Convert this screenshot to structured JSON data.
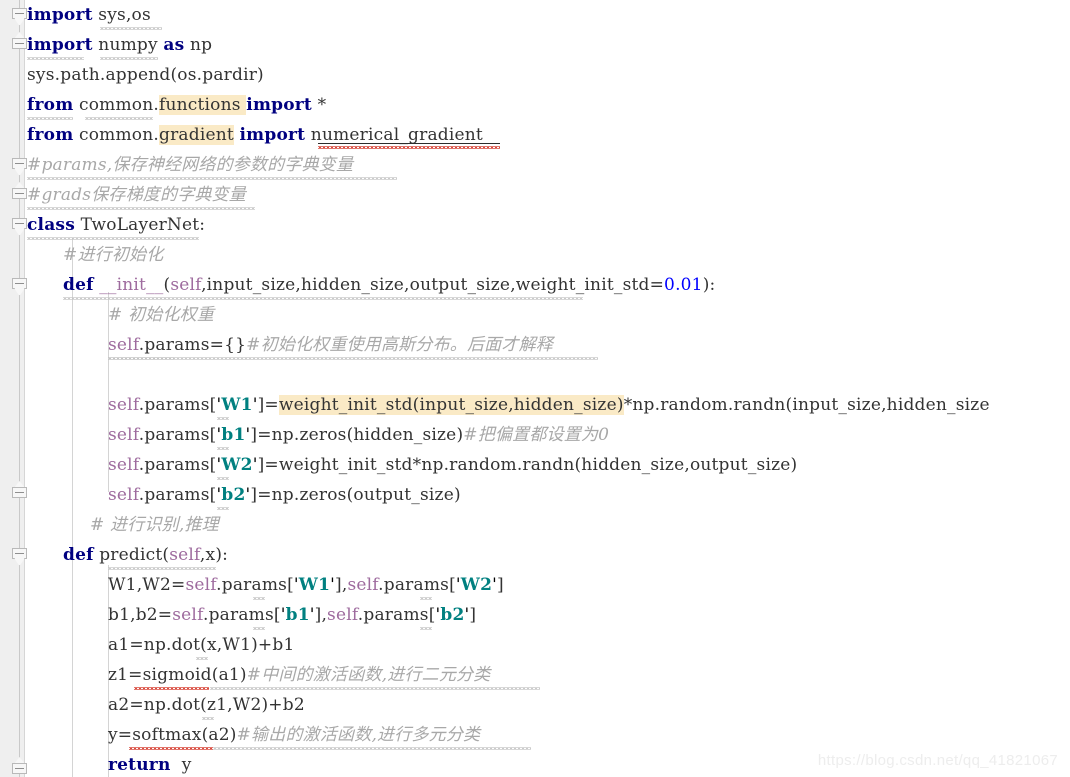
{
  "editor": {
    "language": "python",
    "font_size_px": 17,
    "line_height_px": 30,
    "background": "#ffffff",
    "gutter_background": "#efefef",
    "highlight_color": "#faeac6",
    "comment_color": "#a8a8a8",
    "keyword_color": "#000080",
    "string_color": "#008080",
    "self_color": "#9e6b9e",
    "number_color": "#0000ff"
  },
  "watermark": {
    "text": "https://blog.csdn.net/qq_41821067"
  },
  "gutter": {
    "fold_markers": [
      {
        "name": "fold-marker-import-sys",
        "type": "cap-down"
      },
      {
        "name": "fold-marker-import-numpy",
        "type": "cap-up"
      },
      {
        "name": "fold-marker-comment-params",
        "type": "cap-down"
      },
      {
        "name": "fold-marker-comment-grads",
        "type": "cap-up"
      },
      {
        "name": "fold-marker-class-twolayernet",
        "type": "cap-down"
      },
      {
        "name": "fold-marker-def-init",
        "type": "cap-down"
      },
      {
        "name": "fold-marker-init-end",
        "type": "cap-up"
      },
      {
        "name": "fold-marker-def-predict",
        "type": "cap-down"
      },
      {
        "name": "fold-marker-predict-end",
        "type": "cap-up"
      }
    ]
  },
  "code": {
    "lines": [
      {
        "n": 1,
        "name": "code-line-import-sys-os",
        "text": "import sys,os",
        "tokens": [
          {
            "t": "import",
            "c": "kw"
          },
          {
            "t": " sys,os",
            "c": "plain"
          }
        ]
      },
      {
        "n": 2,
        "name": "code-line-import-numpy",
        "text": "import numpy as np",
        "tokens": [
          {
            "t": "import",
            "c": "kw"
          },
          {
            "t": " numpy ",
            "c": "plain"
          },
          {
            "t": "as",
            "c": "kw"
          },
          {
            "t": " np",
            "c": "plain"
          }
        ]
      },
      {
        "n": 3,
        "name": "code-line-sys-path-append",
        "text": "sys.path.append(os.pardir)",
        "tokens": [
          {
            "t": "sys.path.append(os.pardir)",
            "c": "plain"
          }
        ]
      },
      {
        "n": 4,
        "name": "code-line-from-common-functions",
        "text": "from common.functions import *",
        "tokens": [
          {
            "t": "from",
            "c": "kw"
          },
          {
            "t": " common.",
            "c": "plain"
          },
          {
            "t": "functions",
            "c": "plain hl"
          },
          {
            "t": " ",
            "c": "plain hl"
          },
          {
            "t": "import",
            "c": "kw"
          },
          {
            "t": " *",
            "c": "plain"
          }
        ]
      },
      {
        "n": 5,
        "name": "code-line-from-common-gradient",
        "text": "from common.gradient import numerical_gradient",
        "tokens": [
          {
            "t": "from",
            "c": "kw"
          },
          {
            "t": " common.",
            "c": "plain"
          },
          {
            "t": "gradient",
            "c": "plain hl"
          },
          {
            "t": " ",
            "c": "plain"
          },
          {
            "t": "import",
            "c": "kw"
          },
          {
            "t": " numerical_gradient",
            "c": "plain"
          }
        ]
      },
      {
        "n": 6,
        "name": "code-line-comment-params",
        "text": "#params,保存神经网络的参数的字典变量",
        "tokens": [
          {
            "t": "#params,保存神经网络的参数的字典变量",
            "c": "cmt"
          }
        ]
      },
      {
        "n": 7,
        "name": "code-line-comment-grads",
        "text": "#grads保存梯度的字典变量",
        "tokens": [
          {
            "t": "#grads保存梯度的字典变量",
            "c": "cmt"
          }
        ]
      },
      {
        "n": 8,
        "name": "code-line-class-twolayernet",
        "text": "class TwoLayerNet:",
        "tokens": [
          {
            "t": "class",
            "c": "kw"
          },
          {
            "t": " TwoLayerNet:",
            "c": "plain"
          }
        ]
      },
      {
        "n": 9,
        "name": "code-line-comment-init",
        "text": "#进行初始化",
        "tokens": [
          {
            "t": "#进行初始化",
            "c": "cmt"
          }
        ]
      },
      {
        "n": 10,
        "name": "code-line-def-init",
        "text": "def __init__(self,input_size,hidden_size,output_size,weight_init_std=0.01):",
        "tokens": [
          {
            "t": "def",
            "c": "kw"
          },
          {
            "t": " ",
            "c": "plain"
          },
          {
            "t": "__init__",
            "c": "self"
          },
          {
            "t": "(",
            "c": "plain"
          },
          {
            "t": "self",
            "c": "self"
          },
          {
            "t": ",input_size,hidden_size,output_size,weight_init_std=",
            "c": "plain"
          },
          {
            "t": "0.01",
            "c": "num"
          },
          {
            "t": "):",
            "c": "plain"
          }
        ]
      },
      {
        "n": 11,
        "name": "code-line-comment-init-weights",
        "text": "# 初始化权重",
        "tokens": [
          {
            "t": "# 初始化权重",
            "c": "cmt"
          }
        ]
      },
      {
        "n": 12,
        "name": "code-line-params-dict",
        "text": "self.params={}#初始化权重使用高斯分布。后面才解释",
        "tokens": [
          {
            "t": "self",
            "c": "self"
          },
          {
            "t": ".params={}",
            "c": "plain"
          },
          {
            "t": "#初始化权重使用高斯分布。后面才解释",
            "c": "cmt"
          }
        ]
      },
      {
        "n": 13,
        "name": "code-line-blank",
        "text": "",
        "tokens": []
      },
      {
        "n": 14,
        "name": "code-line-params-w1",
        "text": "self.params['W1']=weight_init_std(input_size,hidden_size)*np.random.randn(input_size,hidden_size",
        "tokens": [
          {
            "t": "self",
            "c": "self"
          },
          {
            "t": ".params[",
            "c": "plain"
          },
          {
            "t": "'",
            "c": "quote"
          },
          {
            "t": "W1",
            "c": "str"
          },
          {
            "t": "'",
            "c": "quote"
          },
          {
            "t": "]=",
            "c": "plain"
          },
          {
            "t": "weight_init_std(input_size,hidden_size)",
            "c": "plain hl"
          },
          {
            "t": "*np.random.randn(input_size,hidden_size",
            "c": "plain"
          }
        ]
      },
      {
        "n": 15,
        "name": "code-line-params-b1",
        "text": "self.params['b1']=np.zeros(hidden_size)#把偏置都设置为0",
        "tokens": [
          {
            "t": "self",
            "c": "self"
          },
          {
            "t": ".params[",
            "c": "plain"
          },
          {
            "t": "'",
            "c": "quote"
          },
          {
            "t": "b1",
            "c": "str"
          },
          {
            "t": "'",
            "c": "quote"
          },
          {
            "t": "]=np.zeros(hidden_size)",
            "c": "plain"
          },
          {
            "t": "#把偏置都设置为0",
            "c": "cmt"
          }
        ]
      },
      {
        "n": 16,
        "name": "code-line-params-w2",
        "text": "self.params['W2']=weight_init_std*np.random.randn(hidden_size,output_size)",
        "tokens": [
          {
            "t": "self",
            "c": "self"
          },
          {
            "t": ".params[",
            "c": "plain"
          },
          {
            "t": "'",
            "c": "quote"
          },
          {
            "t": "W2",
            "c": "str"
          },
          {
            "t": "'",
            "c": "quote"
          },
          {
            "t": "]=weight_init_std*np.random.randn(hidden_size,output_size)",
            "c": "plain"
          }
        ]
      },
      {
        "n": 17,
        "name": "code-line-params-b2",
        "text": "self.params['b2']=np.zeros(output_size)",
        "tokens": [
          {
            "t": "self",
            "c": "self"
          },
          {
            "t": ".params[",
            "c": "plain"
          },
          {
            "t": "'",
            "c": "quote"
          },
          {
            "t": "b2",
            "c": "str"
          },
          {
            "t": "'",
            "c": "quote"
          },
          {
            "t": "]=np.zeros(output_size)",
            "c": "plain"
          }
        ]
      },
      {
        "n": 18,
        "name": "code-line-comment-predict",
        "text": "# 进行识别,推理",
        "tokens": [
          {
            "t": "# 进行识别,推理",
            "c": "cmt"
          }
        ]
      },
      {
        "n": 19,
        "name": "code-line-def-predict",
        "text": "def predict(self,x):",
        "tokens": [
          {
            "t": "def",
            "c": "kw"
          },
          {
            "t": " predict(",
            "c": "plain"
          },
          {
            "t": "self",
            "c": "self"
          },
          {
            "t": ",x):",
            "c": "plain"
          }
        ]
      },
      {
        "n": 20,
        "name": "code-line-assign-w1-w2",
        "text": "W1,W2=self.params['W1'],self.params['W2']",
        "tokens": [
          {
            "t": "W1,W2=",
            "c": "plain"
          },
          {
            "t": "self",
            "c": "self"
          },
          {
            "t": ".params[",
            "c": "plain"
          },
          {
            "t": "'",
            "c": "quote"
          },
          {
            "t": "W1",
            "c": "str"
          },
          {
            "t": "'",
            "c": "quote"
          },
          {
            "t": "],",
            "c": "plain"
          },
          {
            "t": "self",
            "c": "self"
          },
          {
            "t": ".params[",
            "c": "plain"
          },
          {
            "t": "'",
            "c": "quote"
          },
          {
            "t": "W2",
            "c": "str"
          },
          {
            "t": "'",
            "c": "quote"
          },
          {
            "t": "]",
            "c": "plain"
          }
        ]
      },
      {
        "n": 21,
        "name": "code-line-assign-b1-b2",
        "text": "b1,b2=self.params['b1'],self.params['b2']",
        "tokens": [
          {
            "t": "b1,b2=",
            "c": "plain"
          },
          {
            "t": "self",
            "c": "self"
          },
          {
            "t": ".params[",
            "c": "plain"
          },
          {
            "t": "'",
            "c": "quote"
          },
          {
            "t": "b1",
            "c": "str"
          },
          {
            "t": "'",
            "c": "quote"
          },
          {
            "t": "],",
            "c": "plain"
          },
          {
            "t": "self",
            "c": "self"
          },
          {
            "t": ".params[",
            "c": "plain"
          },
          {
            "t": "'",
            "c": "quote"
          },
          {
            "t": "b2",
            "c": "str"
          },
          {
            "t": "'",
            "c": "quote"
          },
          {
            "t": "]",
            "c": "plain"
          }
        ]
      },
      {
        "n": 22,
        "name": "code-line-a1",
        "text": "a1=np.dot(x,W1)+b1",
        "tokens": [
          {
            "t": "a1=np.dot(x,W1)+b1",
            "c": "plain"
          }
        ]
      },
      {
        "n": 23,
        "name": "code-line-z1-sigmoid",
        "text": "z1=sigmoid(a1)#中间的激活函数,进行二元分类",
        "tokens": [
          {
            "t": "z1=sigmoid(a1)",
            "c": "plain"
          },
          {
            "t": "#中间的激活函数,进行二元分类",
            "c": "cmt"
          }
        ]
      },
      {
        "n": 24,
        "name": "code-line-a2",
        "text": "a2=np.dot(z1,W2)+b2",
        "tokens": [
          {
            "t": "a2=np.dot(z1,W2)+b2",
            "c": "plain"
          }
        ]
      },
      {
        "n": 25,
        "name": "code-line-y-softmax",
        "text": "y=softmax(a2)#输出的激活函数,进行多元分类",
        "tokens": [
          {
            "t": "y=softmax(a2)",
            "c": "plain"
          },
          {
            "t": "#输出的激活函数,进行多元分类",
            "c": "cmt"
          }
        ]
      },
      {
        "n": 26,
        "name": "code-line-return-y",
        "text": "return y",
        "tokens": [
          {
            "t": "return",
            "c": "kw"
          },
          {
            "t": "  y",
            "c": "plain"
          }
        ]
      }
    ]
  }
}
